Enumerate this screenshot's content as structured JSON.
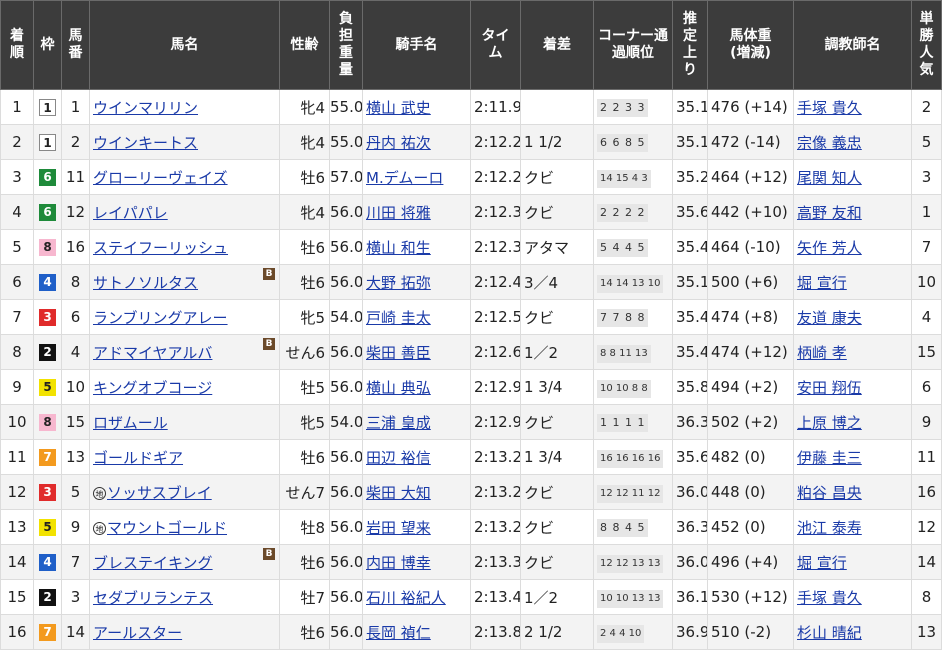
{
  "headers": {
    "finish": "着順",
    "frame": "枠",
    "number": "馬番",
    "horse": "馬名",
    "sexage": "性齢",
    "weight": "負担重量",
    "jockey": "騎手名",
    "time": "タイム",
    "margin": "着差",
    "corner": "コーナー通過順位",
    "last3f": "推定上り",
    "bodyweight": "馬体重(増減)",
    "trainer": "調教師名",
    "popularity": "単勝人気"
  },
  "blinker_label": "B",
  "local_label": "地",
  "rows": [
    {
      "finish": "1",
      "frame": "1",
      "number": "1",
      "horse": "ウインマリリン",
      "blinker": false,
      "local": false,
      "sexage": "牝4",
      "weight": "55.0",
      "jockey": "横山 武史",
      "time": "2:11.9",
      "margin": "",
      "corner": "2 2 3 3",
      "last3f": "35.1",
      "bodyweight": "476 (+14)",
      "trainer": "手塚 貴久",
      "popularity": "2"
    },
    {
      "finish": "2",
      "frame": "1",
      "number": "2",
      "horse": "ウインキートス",
      "blinker": false,
      "local": false,
      "sexage": "牝4",
      "weight": "55.0",
      "jockey": "丹内 祐次",
      "time": "2:12.2",
      "margin": "1 1/2",
      "corner": "6 6 8 5",
      "last3f": "35.1",
      "bodyweight": "472 (-14)",
      "trainer": "宗像 義忠",
      "popularity": "5"
    },
    {
      "finish": "3",
      "frame": "6",
      "number": "11",
      "horse": "グローリーヴェイズ",
      "blinker": false,
      "local": false,
      "sexage": "牡6",
      "weight": "57.0",
      "jockey": "M.デムーロ",
      "time": "2:12.2",
      "margin": "クビ",
      "corner": "14 15 4 3",
      "last3f": "35.2",
      "bodyweight": "464 (+12)",
      "trainer": "尾関 知人",
      "popularity": "3"
    },
    {
      "finish": "4",
      "frame": "6",
      "number": "12",
      "horse": "レイパパレ",
      "blinker": false,
      "local": false,
      "sexage": "牝4",
      "weight": "56.0",
      "jockey": "川田 将雅",
      "time": "2:12.3",
      "margin": "クビ",
      "corner": "2 2 2 2",
      "last3f": "35.6",
      "bodyweight": "442 (+10)",
      "trainer": "高野 友和",
      "popularity": "1"
    },
    {
      "finish": "5",
      "frame": "8",
      "number": "16",
      "horse": "ステイフーリッシュ",
      "blinker": false,
      "local": false,
      "sexage": "牡6",
      "weight": "56.0",
      "jockey": "横山 和生",
      "time": "2:12.3",
      "margin": "アタマ",
      "corner": "5 4 4 5",
      "last3f": "35.4",
      "bodyweight": "464 (-10)",
      "trainer": "矢作 芳人",
      "popularity": "7"
    },
    {
      "finish": "6",
      "frame": "4",
      "number": "8",
      "horse": "サトノソルタス",
      "blinker": true,
      "local": false,
      "sexage": "牡6",
      "weight": "56.0",
      "jockey": "大野 拓弥",
      "time": "2:12.4",
      "margin": "3／4",
      "corner": "14 14 13 10",
      "last3f": "35.1",
      "bodyweight": "500 (+6)",
      "trainer": "堀 宣行",
      "popularity": "10"
    },
    {
      "finish": "7",
      "frame": "3",
      "number": "6",
      "horse": "ランブリングアレー",
      "blinker": false,
      "local": false,
      "sexage": "牝5",
      "weight": "54.0",
      "jockey": "戸崎 圭太",
      "time": "2:12.5",
      "margin": "クビ",
      "corner": "7 7 8 8",
      "last3f": "35.4",
      "bodyweight": "474 (+8)",
      "trainer": "友道 康夫",
      "popularity": "4"
    },
    {
      "finish": "8",
      "frame": "2",
      "number": "4",
      "horse": "アドマイヤアルバ",
      "blinker": true,
      "local": false,
      "sexage": "せん6",
      "weight": "56.0",
      "jockey": "柴田 善臣",
      "time": "2:12.6",
      "margin": "1／2",
      "corner": "8 8 11 13",
      "last3f": "35.4",
      "bodyweight": "474 (+12)",
      "trainer": "柄崎 孝",
      "popularity": "15"
    },
    {
      "finish": "9",
      "frame": "5",
      "number": "10",
      "horse": "キングオブコージ",
      "blinker": false,
      "local": false,
      "sexage": "牡5",
      "weight": "56.0",
      "jockey": "横山 典弘",
      "time": "2:12.9",
      "margin": "1 3/4",
      "corner": "10 10 8 8",
      "last3f": "35.8",
      "bodyweight": "494 (+2)",
      "trainer": "安田 翔伍",
      "popularity": "6"
    },
    {
      "finish": "10",
      "frame": "8",
      "number": "15",
      "horse": "ロザムール",
      "blinker": false,
      "local": false,
      "sexage": "牝5",
      "weight": "54.0",
      "jockey": "三浦 皇成",
      "time": "2:12.9",
      "margin": "クビ",
      "corner": "1 1 1 1",
      "last3f": "36.3",
      "bodyweight": "502 (+2)",
      "trainer": "上原 博之",
      "popularity": "9"
    },
    {
      "finish": "11",
      "frame": "7",
      "number": "13",
      "horse": "ゴールドギア",
      "blinker": false,
      "local": false,
      "sexage": "牡6",
      "weight": "56.0",
      "jockey": "田辺 裕信",
      "time": "2:13.2",
      "margin": "1 3/4",
      "corner": "16 16 16 16",
      "last3f": "35.6",
      "bodyweight": "482 (0)",
      "trainer": "伊藤 圭三",
      "popularity": "11"
    },
    {
      "finish": "12",
      "frame": "3",
      "number": "5",
      "horse": "ソッサスブレイ",
      "blinker": false,
      "local": true,
      "sexage": "せん7",
      "weight": "56.0",
      "jockey": "柴田 大知",
      "time": "2:13.2",
      "margin": "クビ",
      "corner": "12 12 11 12",
      "last3f": "36.0",
      "bodyweight": "448 (0)",
      "trainer": "粕谷 昌央",
      "popularity": "16"
    },
    {
      "finish": "13",
      "frame": "5",
      "number": "9",
      "horse": "マウントゴールド",
      "blinker": false,
      "local": true,
      "sexage": "牡8",
      "weight": "56.0",
      "jockey": "岩田 望来",
      "time": "2:13.2",
      "margin": "クビ",
      "corner": "8 8 4 5",
      "last3f": "36.3",
      "bodyweight": "452 (0)",
      "trainer": "池江 泰寿",
      "popularity": "12"
    },
    {
      "finish": "14",
      "frame": "4",
      "number": "7",
      "horse": "ブレステイキング",
      "blinker": true,
      "local": false,
      "sexage": "牡6",
      "weight": "56.0",
      "jockey": "内田 博幸",
      "time": "2:13.3",
      "margin": "クビ",
      "corner": "12 12 13 13",
      "last3f": "36.0",
      "bodyweight": "496 (+4)",
      "trainer": "堀 宣行",
      "popularity": "14"
    },
    {
      "finish": "15",
      "frame": "2",
      "number": "3",
      "horse": "セダブリランテス",
      "blinker": false,
      "local": false,
      "sexage": "牡7",
      "weight": "56.0",
      "jockey": "石川 裕紀人",
      "time": "2:13.4",
      "margin": "1／2",
      "corner": "10 10 13 13",
      "last3f": "36.1",
      "bodyweight": "530 (+12)",
      "trainer": "手塚 貴久",
      "popularity": "8"
    },
    {
      "finish": "16",
      "frame": "7",
      "number": "14",
      "horse": "アールスター",
      "blinker": false,
      "local": false,
      "sexage": "牡6",
      "weight": "56.0",
      "jockey": "長岡 禎仁",
      "time": "2:13.8",
      "margin": "2 1/2",
      "corner": "2 4 4 10",
      "last3f": "36.9",
      "bodyweight": "510 (-2)",
      "trainer": "杉山 晴紀",
      "popularity": "13"
    }
  ]
}
